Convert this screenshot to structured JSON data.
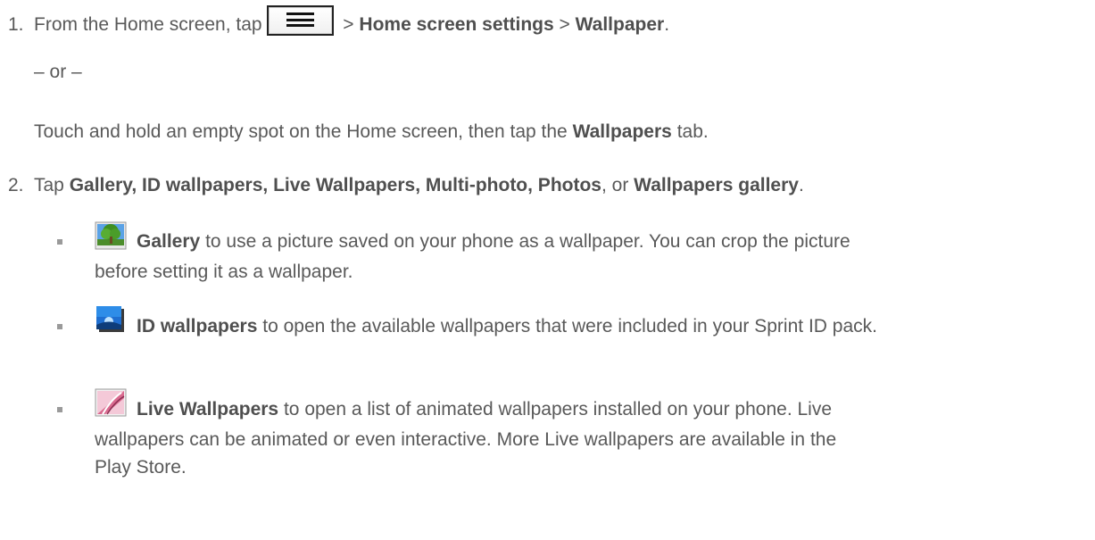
{
  "step1": {
    "number": "1.",
    "prefix": "From the Home screen, tap",
    "sep1": ">",
    "bold1": "Home screen settings",
    "sep2": ">",
    "bold2": "Wallpaper",
    "end": "."
  },
  "or_text": "– or –",
  "alt": {
    "prefix": "Touch and hold an empty spot on the Home screen, then tap the",
    "bold": "Wallpapers",
    "suffix": "tab."
  },
  "step2": {
    "number": "2.",
    "prefix": "Tap",
    "bold1": "Gallery, ID wallpapers, Live Wallpapers, Multi-photo, Photos",
    "middle": ", or",
    "bold2": "Wallpapers gallery",
    "end": "."
  },
  "bullets": [
    {
      "icon": "gallery-icon",
      "title": "Gallery",
      "line1": "to use a picture saved on your phone as a wallpaper. You can crop the picture",
      "line2": "before setting it as a wallpaper."
    },
    {
      "icon": "id-wallpapers-icon",
      "title": "ID wallpapers",
      "line1": "to open the available wallpapers that were included in your Sprint ID pack."
    },
    {
      "icon": "live-wallpapers-icon",
      "title": "Live Wallpapers",
      "line1": "to open a list of animated wallpapers installed on your phone. Live",
      "line2": "wallpapers can be animated or even interactive. More Live wallpapers are available in the",
      "line3": "Play Store."
    }
  ]
}
